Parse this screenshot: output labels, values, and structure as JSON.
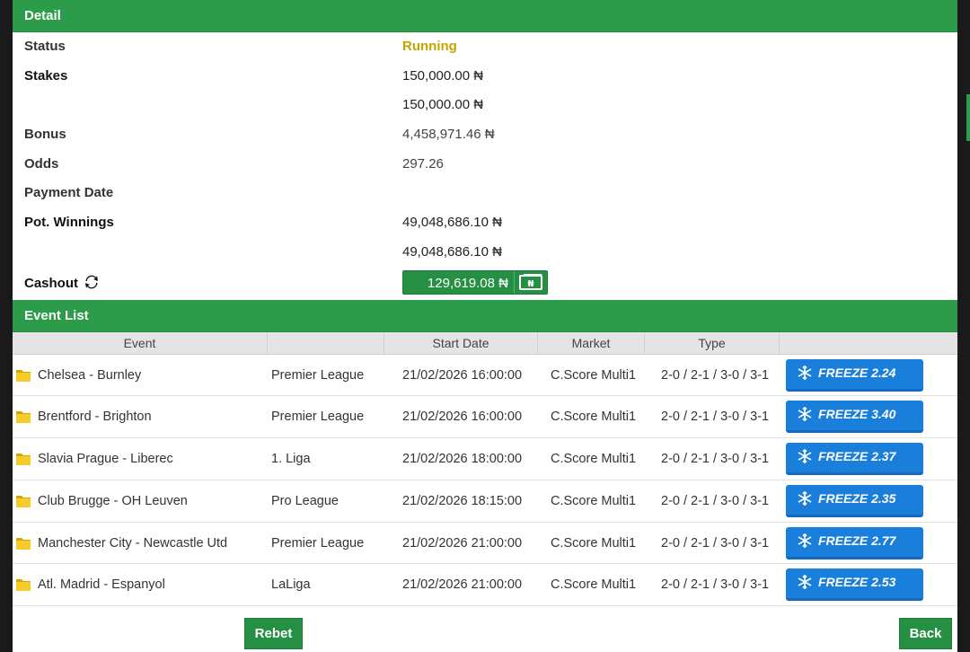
{
  "detail": {
    "header": "Detail",
    "status_label": "Status",
    "status_value": "Running",
    "stakes_label": "Stakes",
    "stakes_value_1": "150,000.00 ₦",
    "stakes_value_2": "150,000.00 ₦",
    "bonus_label": "Bonus",
    "bonus_value": "4,458,971.46 ₦",
    "odds_label": "Odds",
    "odds_value": "297.26",
    "payment_date_label": "Payment Date",
    "payment_date_value": "",
    "pot_winnings_label": "Pot. Winnings",
    "pot_winnings_value_1": "49,048,686.10 ₦",
    "pot_winnings_value_2": "49,048,686.10 ₦",
    "cashout_label": "Cashout",
    "cashout_value": "129,619.08 ₦"
  },
  "events": {
    "header": "Event List",
    "columns": [
      "Event",
      "",
      "Start Date",
      "Market",
      "Type",
      ""
    ],
    "rows": [
      {
        "event": "Chelsea - Burnley",
        "league": "Premier League",
        "date": "21/02/2026 16:00:00",
        "market": "C.Score Multi1",
        "type": "2-0 / 2-1 / 3-0 / 3-1",
        "freeze": "FREEZE 2.24"
      },
      {
        "event": "Brentford - Brighton",
        "league": "Premier League",
        "date": "21/02/2026 16:00:00",
        "market": "C.Score Multi1",
        "type": "2-0 / 2-1 / 3-0 / 3-1",
        "freeze": "FREEZE 3.40"
      },
      {
        "event": "Slavia Prague - Liberec",
        "league": "1. Liga",
        "date": "21/02/2026 18:00:00",
        "market": "C.Score Multi1",
        "type": "2-0 / 2-1 / 3-0 / 3-1",
        "freeze": "FREEZE 2.37"
      },
      {
        "event": "Club Brugge - OH Leuven",
        "league": "Pro League",
        "date": "21/02/2026 18:15:00",
        "market": "C.Score Multi1",
        "type": "2-0 / 2-1 / 3-0 / 3-1",
        "freeze": "FREEZE 2.35"
      },
      {
        "event": "Manchester City - Newcastle Utd",
        "league": "Premier League",
        "date": "21/02/2026 21:00:00",
        "market": "C.Score Multi1",
        "type": "2-0 / 2-1 / 3-0 / 3-1",
        "freeze": "FREEZE 2.77"
      },
      {
        "event": "Atl. Madrid - Espanyol",
        "league": "LaLiga",
        "date": "21/02/2026 21:00:00",
        "market": "C.Score Multi1",
        "type": "2-0 / 2-1 / 3-0 / 3-1",
        "freeze": "FREEZE 2.53"
      }
    ]
  },
  "footer": {
    "rebet_label": "Rebet",
    "back_label": "Back"
  },
  "colors": {
    "header_green": "#2c9b4a",
    "status_running": "#c6a500",
    "freeze_blue": "#1a7fdb"
  },
  "icons": {
    "cashout": "refresh-arrows-icon",
    "money": "banknote-icon",
    "freeze": "snowflake-icon",
    "event": "folder-icon"
  }
}
